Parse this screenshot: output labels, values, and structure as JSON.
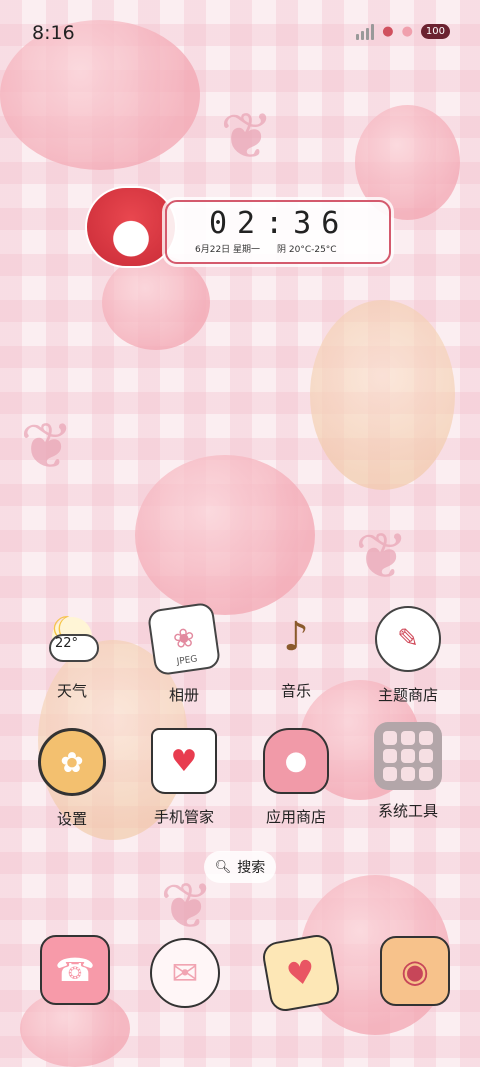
{
  "status_bar": {
    "time": "8:16",
    "battery": "100"
  },
  "clock_widget": {
    "time": "02:36",
    "date": "6月22日 星期一",
    "weather": "阴 20°C-25°C"
  },
  "apps": [
    {
      "label": "天气",
      "icon": "weather-icon",
      "detail": "22°"
    },
    {
      "label": "相册",
      "icon": "gallery-icon",
      "detail": "JPEG"
    },
    {
      "label": "音乐",
      "icon": "music-icon"
    },
    {
      "label": "主题商店",
      "icon": "theme-store-icon"
    },
    {
      "label": "设置",
      "icon": "settings-icon"
    },
    {
      "label": "手机管家",
      "icon": "phone-manager-icon"
    },
    {
      "label": "应用商店",
      "icon": "app-store-icon"
    },
    {
      "label": "系统工具",
      "icon": "system-tools-folder-icon"
    }
  ],
  "search": {
    "label": "搜索",
    "icon": "search-icon"
  },
  "dock": [
    {
      "icon": "phone-icon"
    },
    {
      "icon": "messages-icon"
    },
    {
      "icon": "email-icon"
    },
    {
      "icon": "camera-icon"
    }
  ],
  "colors": {
    "accent": "#d45a6d",
    "wallpaper": "#fbeef1"
  }
}
